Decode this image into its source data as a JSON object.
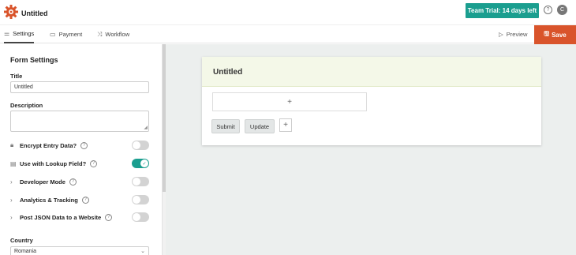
{
  "header": {
    "title": "Untitled",
    "trial_badge": "Team Trial: 14 days left",
    "help": "?",
    "avatar_initial": "C",
    "accent_color": "#1a9e8f"
  },
  "toolbar": {
    "tabs": [
      {
        "label": "Settings",
        "icon": "sliders-icon"
      },
      {
        "label": "Payment",
        "icon": "card-icon"
      },
      {
        "label": "Workflow",
        "icon": "shuffle-icon"
      }
    ],
    "preview_label": "Preview",
    "save_label": "Save",
    "save_color": "#d9542b"
  },
  "sidebar": {
    "heading": "Form Settings",
    "title_label": "Title",
    "title_value": "Untitled",
    "description_label": "Description",
    "description_value": "",
    "toggles": [
      {
        "label": "Encrypt Entry Data?",
        "icon": "lock-icon",
        "on": false
      },
      {
        "label": "Use with Lookup Field?",
        "icon": "lookup-icon",
        "on": true
      },
      {
        "label": "Developer Mode",
        "icon": "chevron-right-icon",
        "on": false
      },
      {
        "label": "Analytics & Tracking",
        "icon": "chevron-right-icon",
        "on": false
      },
      {
        "label": "Post JSON Data to a Website",
        "icon": "chevron-right-icon",
        "on": false
      }
    ],
    "country_label": "Country",
    "country_value": "Romania"
  },
  "form": {
    "title": "Untitled",
    "add_symbol": "+",
    "submit_label": "Submit",
    "update_label": "Update"
  }
}
